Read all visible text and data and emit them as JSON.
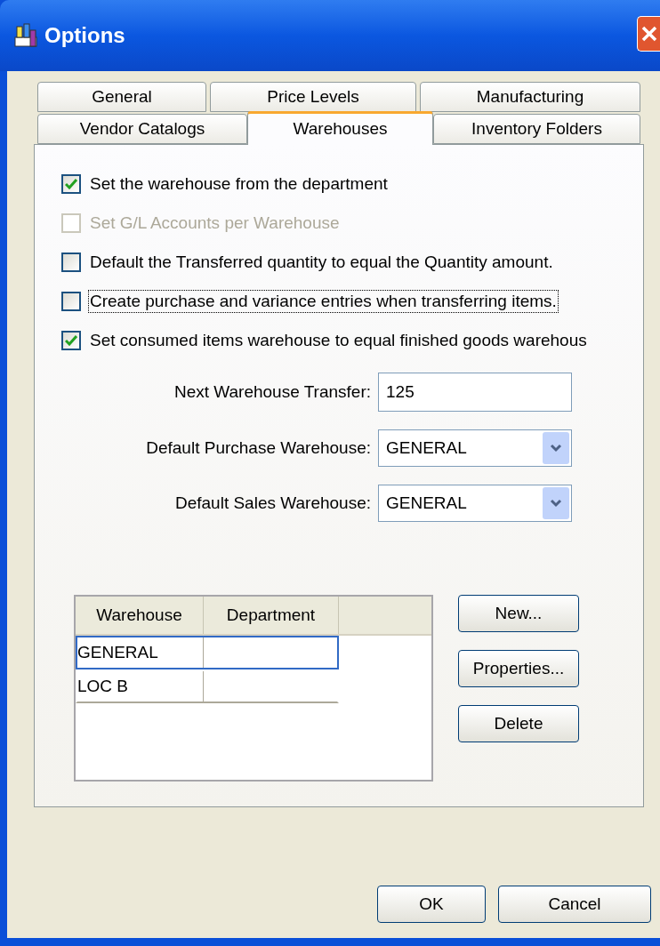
{
  "window": {
    "title": "Options"
  },
  "tab_rows": [
    {
      "tabs": [
        {
          "label": "General",
          "selected": false
        },
        {
          "label": "Price Levels",
          "selected": false
        },
        {
          "label": "Manufacturing",
          "selected": false
        }
      ]
    },
    {
      "tabs": [
        {
          "label": "Vendor Catalogs",
          "selected": false
        },
        {
          "label": "Warehouses",
          "selected": true
        },
        {
          "label": "Inventory Folders",
          "selected": false
        }
      ]
    }
  ],
  "checkboxes": [
    {
      "label": "Set the warehouse from the department",
      "checked": true,
      "disabled": false,
      "focused": false
    },
    {
      "label": "Set G/L Accounts per Warehouse",
      "checked": false,
      "disabled": true,
      "focused": false
    },
    {
      "label": "Default the Transferred quantity to equal the Quantity amount.",
      "checked": false,
      "disabled": false,
      "focused": false
    },
    {
      "label": "Create purchase and variance entries when transferring items.",
      "checked": false,
      "disabled": false,
      "focused": true
    },
    {
      "label": "Set consumed items warehouse to equal finished goods warehous",
      "checked": true,
      "disabled": false,
      "focused": false
    }
  ],
  "fields": [
    {
      "kind": "text",
      "label": "Next Warehouse Transfer:",
      "value": "125"
    },
    {
      "kind": "dropdown",
      "label": "Default Purchase Warehouse:",
      "value": "GENERAL"
    },
    {
      "kind": "dropdown",
      "label": "Default Sales Warehouse:",
      "value": "GENERAL"
    }
  ],
  "table": {
    "columns": [
      "Warehouse",
      "Department"
    ],
    "rows": [
      {
        "warehouse": "GENERAL",
        "selected": true
      },
      {
        "warehouse": "LOC B",
        "selected": false
      }
    ]
  },
  "side_buttons": [
    "New...",
    "Properties...",
    "Delete"
  ],
  "buttons": [
    "OK",
    "Cancel"
  ]
}
